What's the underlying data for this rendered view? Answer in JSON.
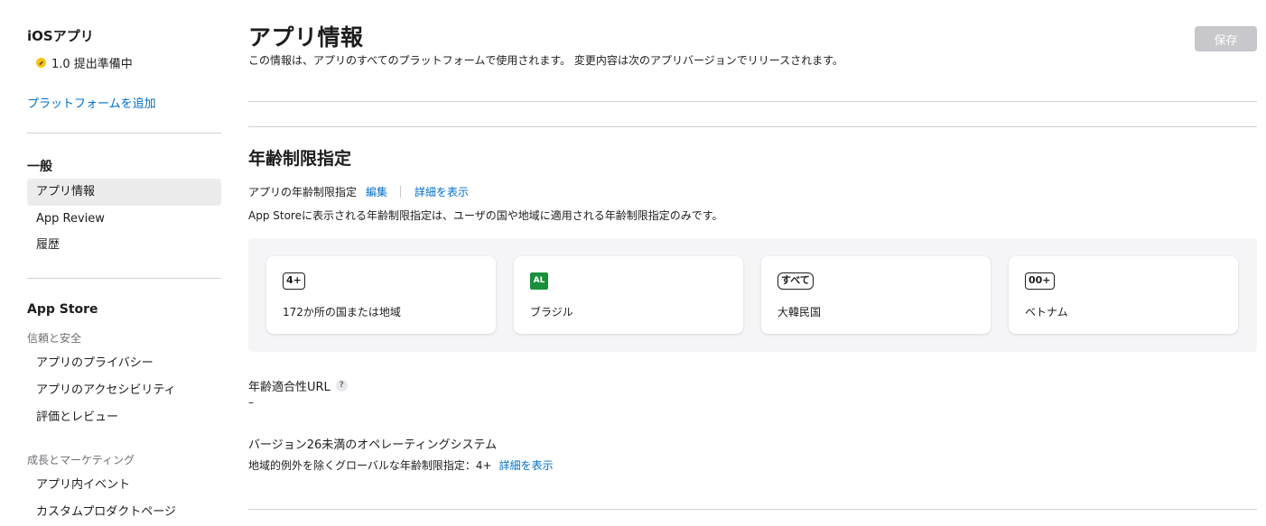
{
  "sidebar": {
    "app_title": "iOSアプリ",
    "version": "1.0 提出準備中",
    "status_color": "#f5c518",
    "add_platform": "プラットフォームを追加",
    "general_title": "一般",
    "general_items": [
      "アプリ情報",
      "App Review",
      "履歴"
    ],
    "appstore_title": "App Store",
    "trust_title": "信頼と安全",
    "trust_items": [
      "アプリのプライバシー",
      "アプリのアクセシビリティ",
      "評価とレビュー"
    ],
    "growth_title": "成長とマーケティング",
    "growth_items": [
      "アプリ内イベント",
      "カスタムプロダクトページ"
    ]
  },
  "main": {
    "title": "アプリ情報",
    "description": "この情報は、アプリのすべてのプラットフォームで使用されます。 変更内容は次のアプリバージョンでリリースされます。",
    "save_label": "保存",
    "age_rating": {
      "title": "年齢制限指定",
      "label": "アプリの年齢制限指定",
      "edit": "編集",
      "details": "詳細を表示",
      "note": "App Storeに表示される年齢制限指定は、ユーザの国や地域に適用される年齢制限指定のみです。",
      "cards": [
        {
          "badge": "4+",
          "label": "172か所の国または地域"
        },
        {
          "badge": "AL",
          "label": "ブラジル"
        },
        {
          "badge": "すべて",
          "label": "大韓民国"
        },
        {
          "badge": "00+",
          "label": "ベトナム"
        }
      ]
    },
    "url_label": "年齢適合性URL",
    "url_help": "?",
    "url_value": "–",
    "os_title": "バージョン26未満のオペレーティングシステム",
    "os_rating": "地域的例外を除くグローバルな年齢制限指定：4+",
    "os_details": "詳細を表示"
  },
  "colors": {
    "accent": "#0070c9",
    "brazil_badge": "#1a8f3c"
  }
}
